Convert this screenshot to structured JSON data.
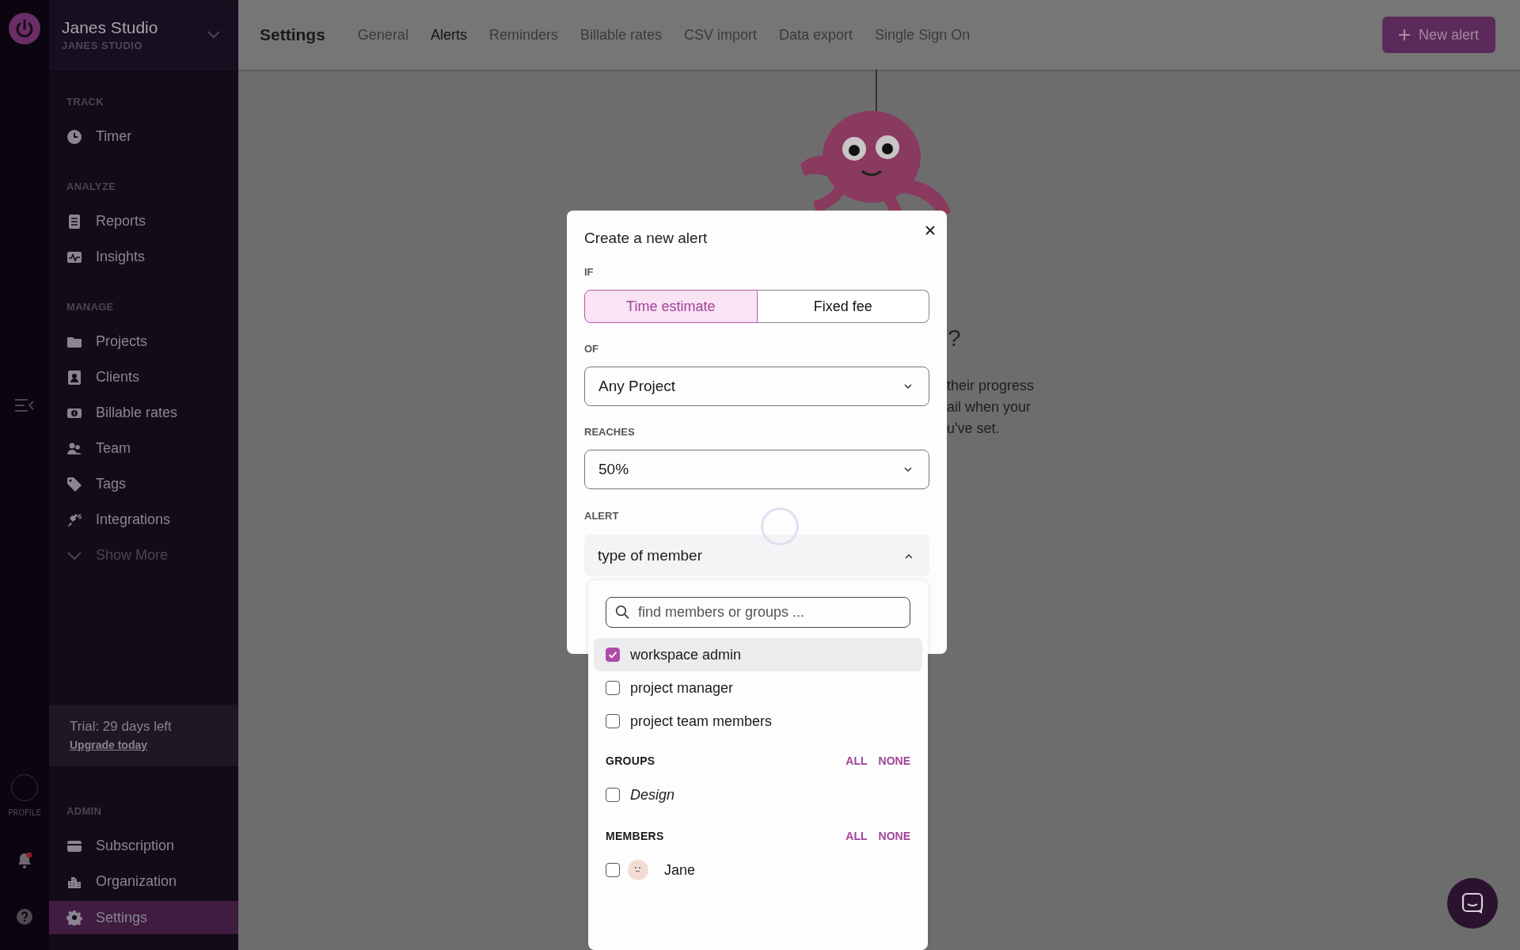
{
  "workspace": {
    "name": "Janes Studio",
    "subtitle": "JANES STUDIO"
  },
  "rail": {
    "profile_label": "PROFILE",
    "notification": true
  },
  "sidebar": {
    "sections": [
      {
        "title": "TRACK",
        "items": [
          {
            "label": "Timer",
            "selected": false
          }
        ]
      },
      {
        "title": "ANALYZE",
        "items": [
          {
            "label": "Reports",
            "selected": false
          },
          {
            "label": "Insights",
            "selected": false
          }
        ]
      },
      {
        "title": "MANAGE",
        "items": [
          {
            "label": "Projects",
            "selected": false
          },
          {
            "label": "Clients",
            "selected": false
          },
          {
            "label": "Billable rates",
            "selected": false
          },
          {
            "label": "Team",
            "selected": false
          },
          {
            "label": "Tags",
            "selected": false
          },
          {
            "label": "Integrations",
            "selected": false
          }
        ],
        "show_more": "Show More"
      },
      {
        "title": "ADMIN",
        "items": [
          {
            "label": "Subscription",
            "selected": false
          },
          {
            "label": "Organization",
            "selected": false
          },
          {
            "label": "Settings",
            "selected": true
          }
        ]
      }
    ],
    "trial": {
      "text": "Trial: 29 days left",
      "link": "Upgrade today"
    }
  },
  "header": {
    "title": "Settings",
    "tabs": [
      {
        "label": "General",
        "selected": false
      },
      {
        "label": "Alerts",
        "selected": true
      },
      {
        "label": "Reminders",
        "selected": false
      },
      {
        "label": "Billable rates",
        "selected": false
      },
      {
        "label": "CSV import",
        "selected": false
      },
      {
        "label": "Data export",
        "selected": false
      },
      {
        "label": "Single Sign On",
        "selected": false
      }
    ],
    "button": "New alert"
  },
  "background": {
    "heading_fragment": "?",
    "lines": [
      "their progress",
      "ail when your",
      "u've set."
    ]
  },
  "modal": {
    "title": "Create a new alert",
    "if": {
      "label": "IF",
      "options": [
        {
          "label": "Time estimate",
          "selected": true
        },
        {
          "label": "Fixed fee",
          "selected": false
        }
      ]
    },
    "of": {
      "label": "OF",
      "value": "Any Project"
    },
    "reaches": {
      "label": "REACHES",
      "value": "50%"
    },
    "alert": {
      "label": "ALERT",
      "value": "type of member",
      "expanded": true
    }
  },
  "dropdown": {
    "placeholder": "find members or groups ...",
    "roles": [
      {
        "label": "workspace admin",
        "checked": true,
        "highlighted": true
      },
      {
        "label": "project manager",
        "checked": false,
        "highlighted": false
      },
      {
        "label": "project team members",
        "checked": false,
        "highlighted": false
      }
    ],
    "groups": {
      "title": "GROUPS",
      "all": "ALL",
      "none": "NONE",
      "items": [
        {
          "label": "Design",
          "checked": false
        }
      ]
    },
    "members": {
      "title": "MEMBERS",
      "all": "ALL",
      "none": "NONE",
      "items": [
        {
          "name": "Jane",
          "checked": false
        }
      ]
    }
  }
}
